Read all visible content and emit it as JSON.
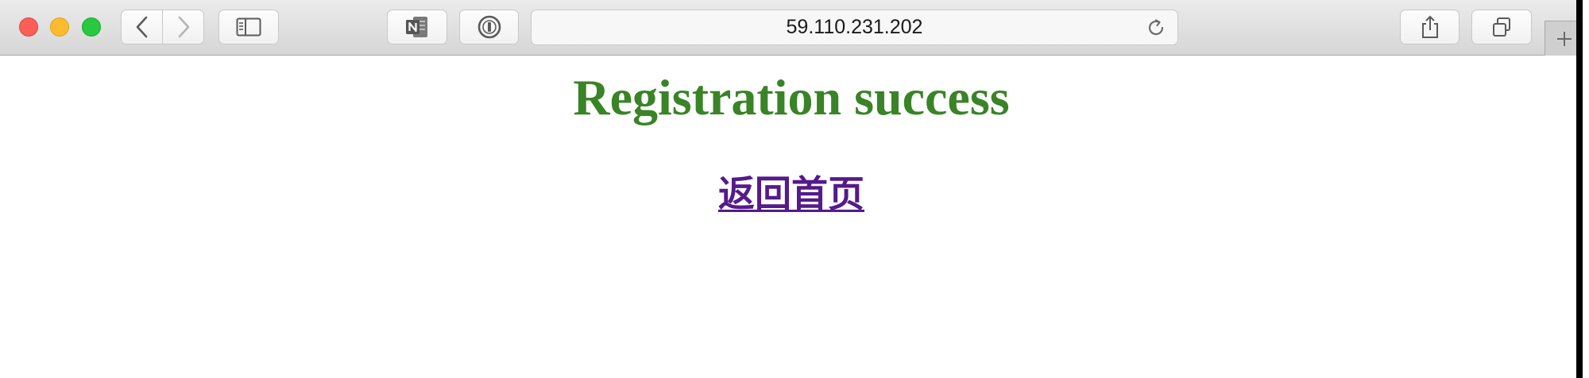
{
  "browser": {
    "address_bar": {
      "url": "59.110.231.202"
    },
    "icons": {
      "back": "chevron-left-icon",
      "forward": "chevron-right-icon",
      "sidebar": "sidebar-icon",
      "onenote": "onenote-icon",
      "password": "password-manager-icon",
      "reload": "reload-icon",
      "share": "share-icon",
      "tabs": "tabs-overview-icon",
      "new_tab": "plus-icon"
    },
    "colors": {
      "close": "#fc5f57",
      "minimize": "#fdbc2e",
      "maximize": "#28c840"
    }
  },
  "page": {
    "heading": "Registration success",
    "home_link": "返回首页",
    "colors": {
      "heading": "#3a8327",
      "link": "#551a8b"
    }
  }
}
